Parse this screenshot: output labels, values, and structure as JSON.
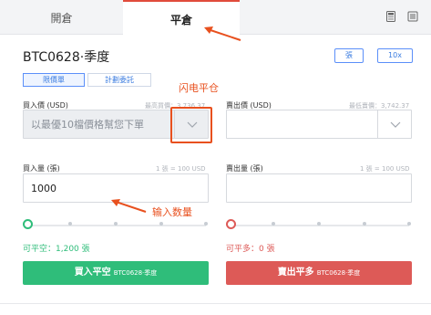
{
  "tabs": {
    "open_label": "開倉",
    "close_label": "平倉"
  },
  "toolbar": {
    "calculator_icon": "calculator-icon",
    "settings_icon": "settings-icon"
  },
  "contract": {
    "title": "BTC0628·季度",
    "unit_button": "張",
    "leverage_button": "10x"
  },
  "order_types": {
    "limit": "限價單",
    "plan": "計劃委託"
  },
  "buy_price": {
    "label": "買入價 (USD)",
    "hint": "最高買價：3,736.37",
    "placeholder": "以最優10檔價格幫您下單"
  },
  "sell_price": {
    "label": "賣出價 (USD)",
    "hint": "最低賣價：3,742.37",
    "value": ""
  },
  "buy_amount": {
    "label": "買入量 (張)",
    "hint": "1 張 = 100 USD",
    "value": "1000"
  },
  "sell_amount": {
    "label": "賣出量 (張)",
    "hint": "1 張 = 100 USD",
    "value": ""
  },
  "annotations": {
    "flash_close": "闪电平仓",
    "enter_quantity": "输入数量"
  },
  "availability": {
    "buy": "可平空：1,200 張",
    "sell": "可平多：0 張"
  },
  "actions": {
    "buy_label": "買入平空",
    "buy_sub": "BTC0628·季度",
    "sell_label": "賣出平多",
    "sell_sub": "BTC0628·季度"
  },
  "colors": {
    "buy": "#2fbd7a",
    "sell": "#dd5a57",
    "accent": "#3b7ce0",
    "annotation": "#e8501e"
  }
}
